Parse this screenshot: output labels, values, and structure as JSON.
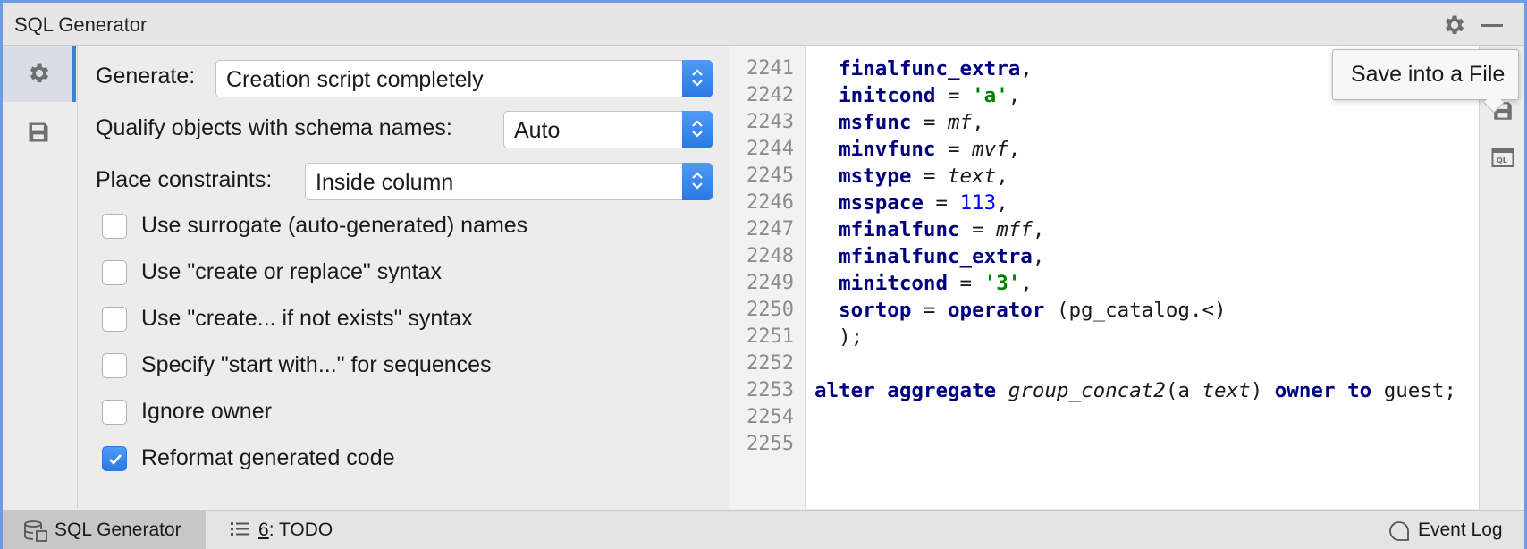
{
  "window": {
    "title": "SQL Generator"
  },
  "left_strip": {
    "items": [
      {
        "icon": "gear-icon",
        "active": true
      },
      {
        "icon": "save-icon",
        "active": false
      }
    ]
  },
  "settings": {
    "generate_label": "Generate:",
    "generate_value": "Creation script completely",
    "qualify_label": "Qualify objects with schema names:",
    "qualify_value": "Auto",
    "constraints_label": "Place constraints:",
    "constraints_value": "Inside column",
    "options": [
      {
        "label": "Use surrogate (auto-generated) names",
        "checked": false
      },
      {
        "label": "Use \"create or replace\" syntax",
        "checked": false
      },
      {
        "label": "Use \"create... if not exists\" syntax",
        "checked": false
      },
      {
        "label": "Specify \"start with...\" for sequences",
        "checked": false
      },
      {
        "label": "Ignore owner",
        "checked": false
      },
      {
        "label": "Reformat generated code",
        "checked": true
      }
    ]
  },
  "editor": {
    "line_numbers": [
      "2241",
      "2242",
      "2243",
      "2244",
      "2245",
      "2246",
      "2247",
      "2248",
      "2249",
      "2250",
      "2251",
      "2252",
      "2253",
      "2254",
      "2255"
    ],
    "code": {
      "l2241_name": "finalfunc_extra",
      "l2242_name": "initcond",
      "l2242_val": "'a'",
      "l2243_name": "msfunc",
      "l2243_val": "mf",
      "l2244_name": "minvfunc",
      "l2244_val": "mvf",
      "l2245_name": "mstype",
      "l2245_val": "text",
      "l2246_name": "msspace",
      "l2246_val": "113",
      "l2247_name": "mfinalfunc",
      "l2247_val": "mff",
      "l2248_name": "mfinalfunc_extra",
      "l2249_name": "minitcond",
      "l2249_val": "'3'",
      "l2250_name": "sortop",
      "l2250_kw": "operator",
      "l2250_val": "(pg_catalog.<)",
      "l2251_text": ");",
      "l2253_kw1": "alter",
      "l2253_kw2": "aggregate",
      "l2253_func": "group_concat2",
      "l2253_arg": "(a ",
      "l2253_type": "text",
      "l2253_close": ")",
      "l2253_kw3": "owner",
      "l2253_kw4": "to",
      "l2253_owner": "guest;"
    }
  },
  "tooltip": {
    "text": "Save into a File"
  },
  "status_bar": {
    "sql_generator_label": "SQL Generator",
    "todo_number": "6",
    "todo_label": ": TODO",
    "event_log_label": "Event Log"
  },
  "colors": {
    "accent": "#3d7fd4",
    "keyword": "#000080",
    "string": "#008000",
    "number": "#0000ff",
    "frame": "#6f9be6"
  }
}
